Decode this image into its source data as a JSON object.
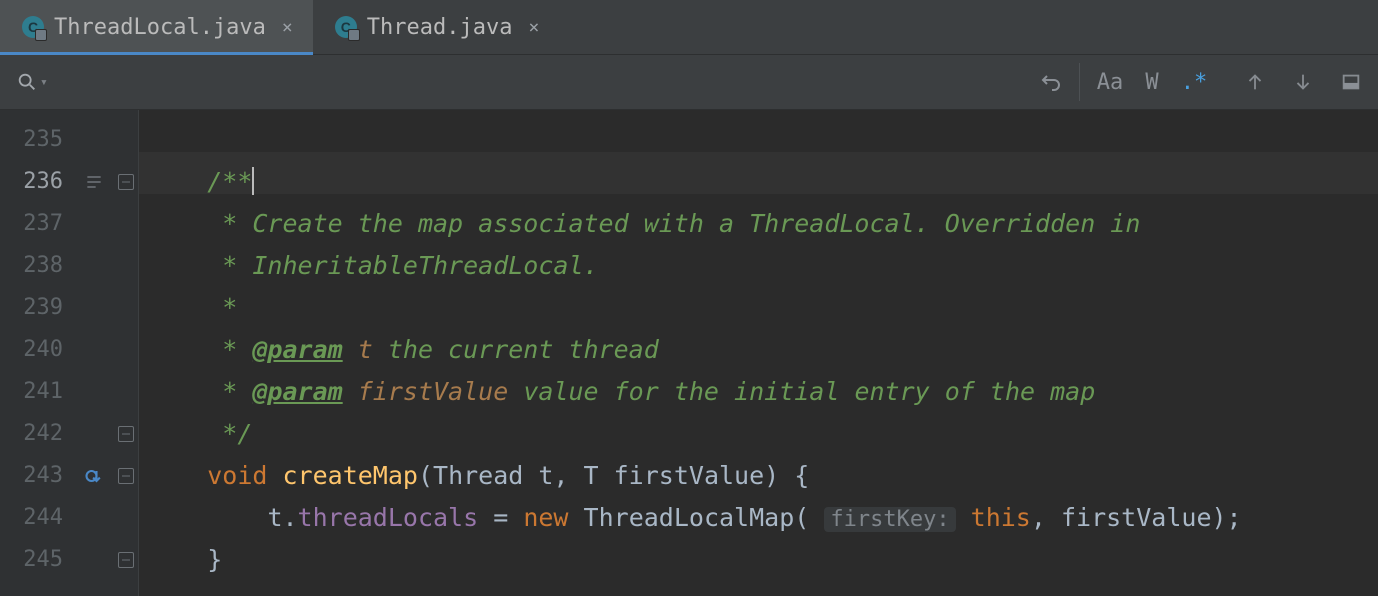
{
  "tabs": [
    {
      "label": "ThreadLocal.java",
      "active": true
    },
    {
      "label": "Thread.java",
      "active": false
    }
  ],
  "find": {
    "matchCase": "Aa",
    "words": "W",
    "regex": ".*"
  },
  "gutter": [
    "235",
    "236",
    "237",
    "238",
    "239",
    "240",
    "241",
    "242",
    "243",
    "244",
    "245"
  ],
  "code": {
    "l236": "/**",
    "l237_a": " * ",
    "l237_b": "Create the map associated with a ThreadLocal. Overridden in",
    "l238_a": " * ",
    "l238_b": "InheritableThreadLocal.",
    "l239": " *",
    "l240_a": " * ",
    "l240_tag": "@param",
    "l240_p": " t ",
    "l240_b": "the current thread",
    "l241_a": " * ",
    "l241_tag": "@param",
    "l241_p": " firstValue ",
    "l241_b": "value for the initial entry of the map",
    "l242": " */",
    "l243_kw": "void",
    "l243_sp1": " ",
    "l243_m": "createMap",
    "l243_sig": "(Thread t, T firstValue) {",
    "l244_indent": "    ",
    "l244_a": "t.",
    "l244_fld": "threadLocals",
    "l244_eq": " = ",
    "l244_new": "new",
    "l244_sp": " ",
    "l244_cls": "ThreadLocalMap( ",
    "l244_hint": "firstKey:",
    "l244_sp2": " ",
    "l244_this": "this",
    "l244_rest": ", firstValue);",
    "l245": "}"
  }
}
